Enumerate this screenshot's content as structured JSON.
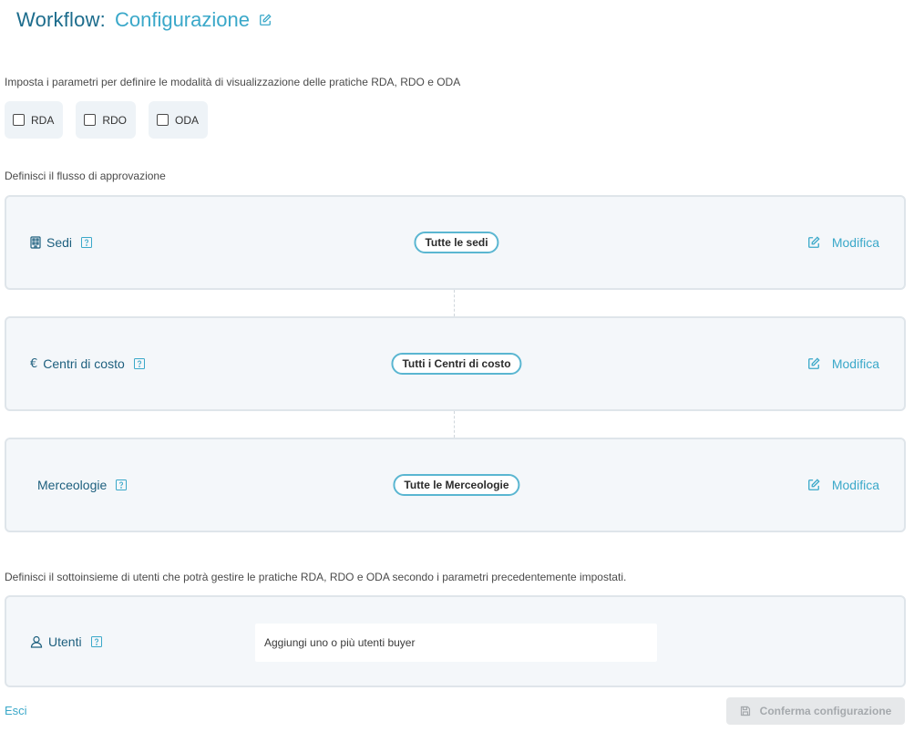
{
  "header": {
    "prefix": "Workflow:",
    "name": "Configurazione"
  },
  "intro_text": "Imposta i parametri per definire le modalità di visualizzazione delle pratiche RDA, RDO e ODA",
  "document_types": [
    {
      "label": "RDA",
      "checked": false
    },
    {
      "label": "RDO",
      "checked": false
    },
    {
      "label": "ODA",
      "checked": false
    }
  ],
  "flow_section_label": "Definisci il flusso di approvazione",
  "flow": [
    {
      "title": "Sedi",
      "icon": "building-icon",
      "value": "Tutte le sedi",
      "edit_label": "Modifica"
    },
    {
      "title": "Centri di costo",
      "icon": "euro-icon",
      "value": "Tutti i Centri di costo",
      "edit_label": "Modifica"
    },
    {
      "title": "Merceologie",
      "icon": "",
      "value": "Tutte le Merceologie",
      "edit_label": "Modifica"
    }
  ],
  "users_section_label": "Definisci il sottoinsieme di utenti che potrà gestire le pratiche RDA, RDO e ODA secondo i parametri precedentemente impostati.",
  "users": {
    "title": "Utenti",
    "icon": "user-icon",
    "placeholder": "Aggiungi uno o più utenti buyer"
  },
  "footer": {
    "exit_label": "Esci",
    "confirm_label": "Conferma configurazione"
  },
  "colors": {
    "accent": "#3aa8c9",
    "title_dark": "#1c6c8c",
    "card_bg": "#f4f7fa",
    "card_border": "#dfe5ea",
    "disabled_bg": "#e6e8ea"
  }
}
